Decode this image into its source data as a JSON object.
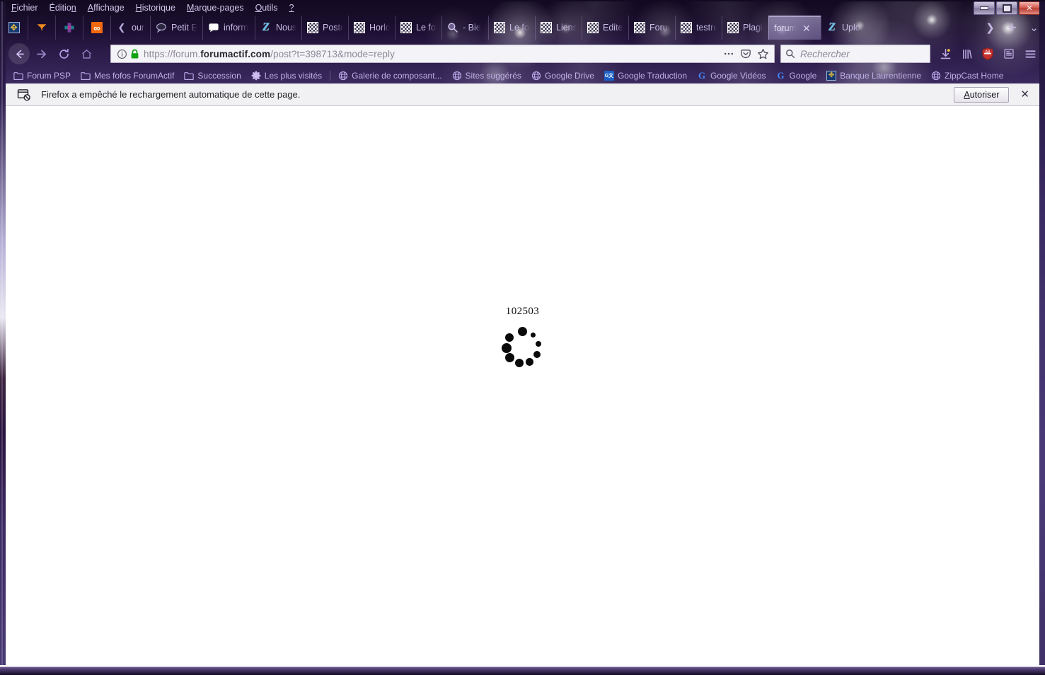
{
  "window": {
    "controls": {
      "minimize": "–",
      "maximize": "□",
      "close": "✕"
    }
  },
  "menubar": {
    "items": [
      {
        "label": "Fichier",
        "accel": "F"
      },
      {
        "label": "Édition",
        "accel": "n"
      },
      {
        "label": "Affichage",
        "accel": "A"
      },
      {
        "label": "Historique",
        "accel": "H"
      },
      {
        "label": "Marque-pages",
        "accel": "M"
      },
      {
        "label": "Outils",
        "accel": "O"
      },
      {
        "label": "?",
        "accel": "?"
      }
    ]
  },
  "tabs": {
    "pinned": [
      {
        "label": "",
        "icon": "bank-favicon"
      },
      {
        "label": "",
        "icon": "funnel-favicon"
      },
      {
        "label": "",
        "icon": "cross-favicon"
      },
      {
        "label": "",
        "icon": "infinity-favicon"
      }
    ],
    "items": [
      {
        "label": "ourri",
        "icon": "chevron-left-icon",
        "active": false
      },
      {
        "label": "Petit E",
        "icon": "speech-bubble-dark-icon",
        "active": false
      },
      {
        "label": "inform",
        "icon": "speech-bubble-light-icon",
        "active": false
      },
      {
        "label": "Nous",
        "icon": "zoho-favicon",
        "active": false
      },
      {
        "label": "Poster",
        "icon": "checker-favicon",
        "active": false
      },
      {
        "label": "Horloc",
        "icon": "checker-favicon",
        "active": false
      },
      {
        "label": "Le fof",
        "icon": "checker-favicon",
        "active": false
      },
      {
        "label": "- Bie",
        "icon": "magnifier-favicon",
        "active": false
      },
      {
        "label": "Le fof",
        "icon": "checker-favicon",
        "active": false
      },
      {
        "label": "Liens",
        "icon": "checker-favicon",
        "active": false
      },
      {
        "label": "Edite",
        "icon": "checker-favicon",
        "active": false
      },
      {
        "label": "Forum",
        "icon": "checker-favicon",
        "active": false
      },
      {
        "label": "testre",
        "icon": "checker-favicon",
        "active": false
      },
      {
        "label": "Plagia",
        "icon": "checker-favicon",
        "active": false
      },
      {
        "label": "forum",
        "icon": "none",
        "active": true,
        "close": "✕"
      },
      {
        "label": "Uploa",
        "icon": "zoho-favicon",
        "active": false
      }
    ],
    "tools": {
      "scroll_right": "❯",
      "new_tab": "+",
      "list_all_tabs": "⌄"
    }
  },
  "navbar": {
    "back": "back-arrow",
    "forward": "forward-arrow",
    "reload": "reload-arrow",
    "home": "home-icon",
    "url": {
      "scheme": "https://",
      "subdomain": "forum.",
      "domain": "forumactif.com",
      "path": "/post?t=398713&mode=reply",
      "full": "https://forum.forumactif.com/post?t=398713&mode=reply",
      "identity_icon": "info-circle-icon",
      "lock_icon": "padlock-secure-icon",
      "page_actions": "ellipsis-icon",
      "pocket": "pocket-icon",
      "bookmark": "star-icon"
    },
    "search": {
      "placeholder": "Rechercher",
      "icon": "search-magnifier-icon"
    },
    "right_icons": [
      {
        "name": "downloads-icon"
      },
      {
        "name": "library-icon"
      },
      {
        "name": "adblock-shield-icon"
      },
      {
        "name": "reader-view-icon"
      },
      {
        "name": "hamburger-menu-icon"
      }
    ]
  },
  "bookmarks": [
    {
      "label": "Forum PSP",
      "icon": "folder-icon"
    },
    {
      "label": "Mes fofos ForumActif",
      "icon": "folder-icon"
    },
    {
      "label": "Succession",
      "icon": "folder-icon"
    },
    {
      "label": "Les plus visités",
      "icon": "gear-icon"
    },
    {
      "label": "Galerie de composant...",
      "icon": "globe-icon"
    },
    {
      "label": "Sites suggérés",
      "icon": "globe-icon"
    },
    {
      "label": "Google Drive",
      "icon": "globe-icon"
    },
    {
      "label": "Google Traduction",
      "icon": "google-translate-icon"
    },
    {
      "label": "Google Vidéos",
      "icon": "google-g-icon"
    },
    {
      "label": "Google",
      "icon": "google-g-icon"
    },
    {
      "label": "Banque Laurentienne",
      "icon": "bank-icon"
    },
    {
      "label": "ZippCast Home",
      "icon": "globe-icon"
    }
  ],
  "notification": {
    "icon": "blocked-reload-icon",
    "message": "Firefox a empêché le rechargement automatique de cette page.",
    "allow_label": "Autoriser",
    "allow_accel": "A",
    "close": "✕"
  },
  "page": {
    "loader_id": "102503",
    "spinner": "loading-spinner"
  },
  "colors": {
    "chrome_purple": "#2a1a47",
    "accent_text": "#c7bde6",
    "page_bg": "#ffffff",
    "notif_bg": "#f1f0f3",
    "lock_green": "#12a312"
  }
}
